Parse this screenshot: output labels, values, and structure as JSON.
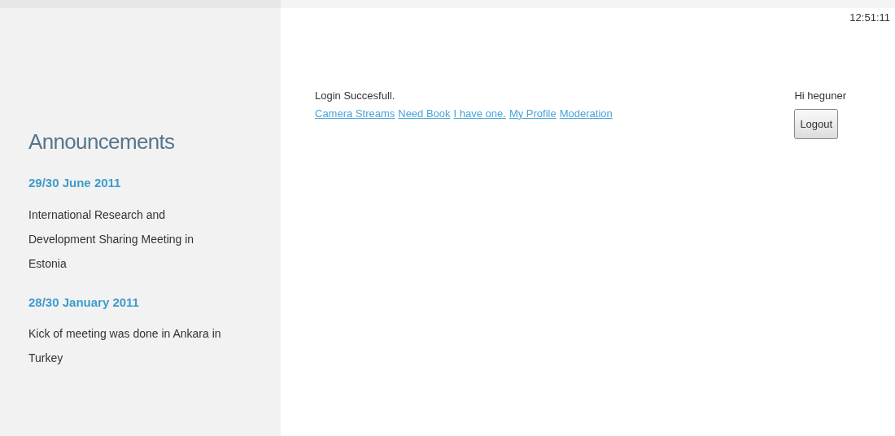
{
  "clock": "12:51:11",
  "announcements": {
    "title": "Announcements",
    "items": [
      {
        "date": "29/30 June 2011",
        "text": "International Research and Development Sharing Meeting in Estonia"
      },
      {
        "date": "28/30 January 2011",
        "text": "Kick of meeting was done in Ankara in Turkey"
      }
    ]
  },
  "message": "Login Succesfull.",
  "links": [
    "Camera Streams",
    "Need Book",
    "I have one.",
    "My Profile",
    "Moderation"
  ],
  "user": {
    "greeting": "Hi heguner",
    "button": "Logout"
  }
}
